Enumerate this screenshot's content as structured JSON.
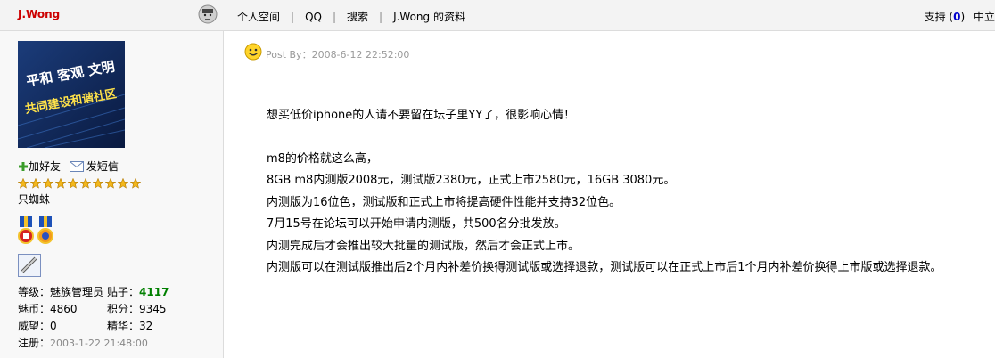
{
  "header": {
    "author": "J.Wong",
    "links": [
      "个人空间",
      "QQ",
      "搜索",
      "J.Wong 的资料"
    ],
    "support_label": "支持",
    "support_count": "0",
    "neutral_label": "中立"
  },
  "profile": {
    "avatar_text_line1": "平和 客观 文明",
    "avatar_text_line2": "共同建设和谐社区",
    "add_friend": "加好友",
    "send_message": "发短信",
    "star_count": 10,
    "user_group": "只蜘蛛",
    "stats": {
      "level_label": "等级：",
      "level_value": "魅族管理员",
      "posts_label": "贴子：",
      "posts_value": "4117",
      "coins_label": "魅币：",
      "coins_value": "4860",
      "points_label": "积分：",
      "points_value": "9345",
      "prestige_label": "威望：",
      "prestige_value": "0",
      "digest_label": "精华：",
      "digest_value": "32",
      "register_label": "注册：",
      "register_value": "2003-1-22 21:48:00"
    }
  },
  "post": {
    "meta": "Post By：2008-6-12 22:52:00",
    "line1": "想买低价iphone的人请不要留在坛子里YY了，很影响心情！",
    "lines": [
      "m8的价格就这么高，",
      "8GB m8内测版2008元，测试版2380元，正式上市2580元，16GB 3080元。",
      "内测版为16位色，测试版和正式上市将提高硬件性能并支持32位色。",
      "7月15号在论坛可以开始申请内测版，共500名分批发放。",
      "内测完成后才会推出较大批量的测试版，然后才会正式上市。",
      "内测版可以在测试版推出后2个月内补差价换得测试版或选择退款，测试版可以在正式上市后1个月内补差价换得上市版或选择退款。"
    ]
  },
  "colors": {
    "author": "#cc0000",
    "posts_count": "#008000",
    "meta_grey": "#999999"
  }
}
